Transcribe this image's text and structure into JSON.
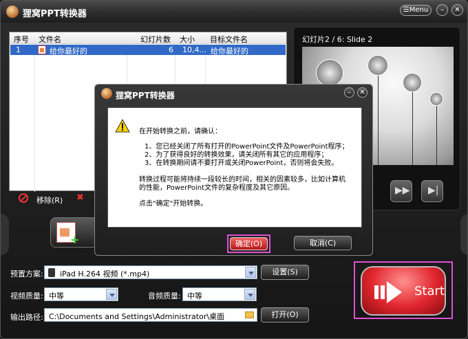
{
  "app": {
    "title": "狸窝PPT转换器",
    "menu_label": "Menu"
  },
  "file_list": {
    "columns": [
      "序号",
      "文件名",
      "幻灯片数",
      "大小",
      "目标文件名"
    ],
    "rows": [
      {
        "index": "1",
        "name": "给你最好的",
        "slides": "6",
        "size": "10,4...",
        "target": "给你最好的"
      }
    ]
  },
  "list_toolbar": {
    "remove_label": "移除(R)"
  },
  "preview": {
    "title": "幻灯片2 / 6: Slide 2"
  },
  "settings": {
    "preset_label": "预置方案:",
    "preset_value": "iPad H.264 视频 (*.mp4)",
    "setup_button": "设置(S)",
    "video_quality_label": "视频质量:",
    "video_quality_value": "中等",
    "audio_quality_label": "音频质量:",
    "audio_quality_value": "中等",
    "output_label": "输出路径:",
    "output_value": "C:\\Documents and Settings\\Administrator\\桌面",
    "open_button": "打开(O)"
  },
  "start_button": "Start",
  "dialog": {
    "title": "狸窝PPT转换器",
    "line_intro": "在开始转换之前，请确认：",
    "line_1": "1、您已经关闭了所有打开的PowerPoint文件及PowerPoint程序；",
    "line_2": "2、为了获得良好的转换效果，请关闭所有其它的应用程序；",
    "line_3": "3、在转换期间请不要打开或关闭PowerPoint，否则将会失败。",
    "line_4": "转换过程可能将持续一段较长的时间，相关的因素较多，比如计算机",
    "line_5": "的性能，PowerPoint文件的复杂程度及其它原因。",
    "line_6": "点击\"确定\"开始转换。",
    "ok_button": "确定(O)",
    "cancel_button": "取消(C)"
  }
}
